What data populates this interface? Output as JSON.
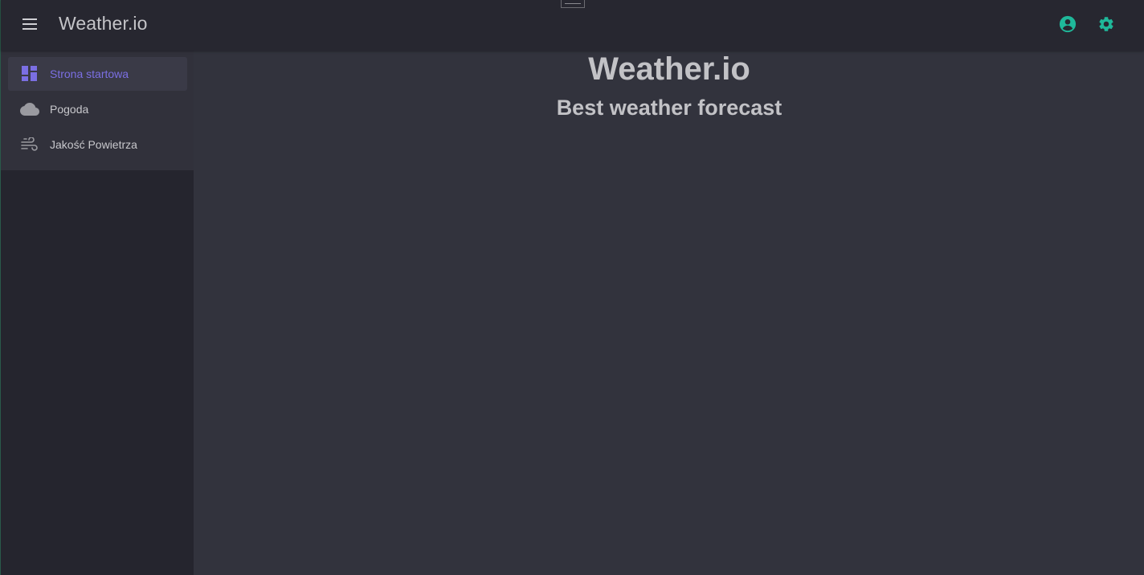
{
  "header": {
    "app_title": "Weather.io",
    "menu_icon": "hamburger-menu-icon",
    "account_icon": "account-circle-icon",
    "settings_icon": "gear-icon",
    "accent_color": "#1fb89a"
  },
  "sidebar": {
    "items": [
      {
        "label": "Strona startowa",
        "icon": "dashboard-icon",
        "active": true
      },
      {
        "label": "Pogoda",
        "icon": "cloud-icon",
        "active": false
      },
      {
        "label": "Jakość Powietrza",
        "icon": "wind-icon",
        "active": false
      }
    ],
    "active_color": "#7b6fe3"
  },
  "main": {
    "title": "Weather.io",
    "subtitle": "Best weather forecast"
  }
}
